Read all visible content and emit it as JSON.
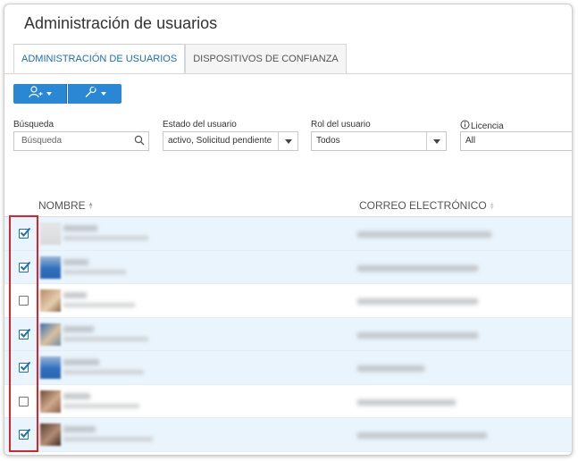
{
  "page": {
    "title": "Administración de usuarios"
  },
  "tabs": [
    {
      "label": "ADMINISTRACIÓN DE USUARIOS",
      "active": true
    },
    {
      "label": "DISPOSITIVOS DE CONFIANZA",
      "active": false
    }
  ],
  "toolbar": {
    "add_user_icon": "add-user-icon",
    "tools_icon": "wrench-icon"
  },
  "filters": {
    "search": {
      "label": "Búsqueda",
      "placeholder": "Búsqueda"
    },
    "status": {
      "label": "Estado del usuario",
      "value": "activo, Solicitud pendiente"
    },
    "role": {
      "label": "Rol del usuario",
      "value": "Todos"
    },
    "license": {
      "label": "Licencia",
      "value": "All"
    }
  },
  "table": {
    "columns": {
      "name": "NOMBRE",
      "email": "CORREO ELECTRÓNICO"
    },
    "rows": [
      {
        "checked": true
      },
      {
        "checked": true
      },
      {
        "checked": false
      },
      {
        "checked": true
      },
      {
        "checked": true
      },
      {
        "checked": false
      },
      {
        "checked": true
      }
    ]
  },
  "colors": {
    "accent": "#2a87d3",
    "selected_row": "#e9f4fc",
    "highlight": "#d9242b"
  }
}
